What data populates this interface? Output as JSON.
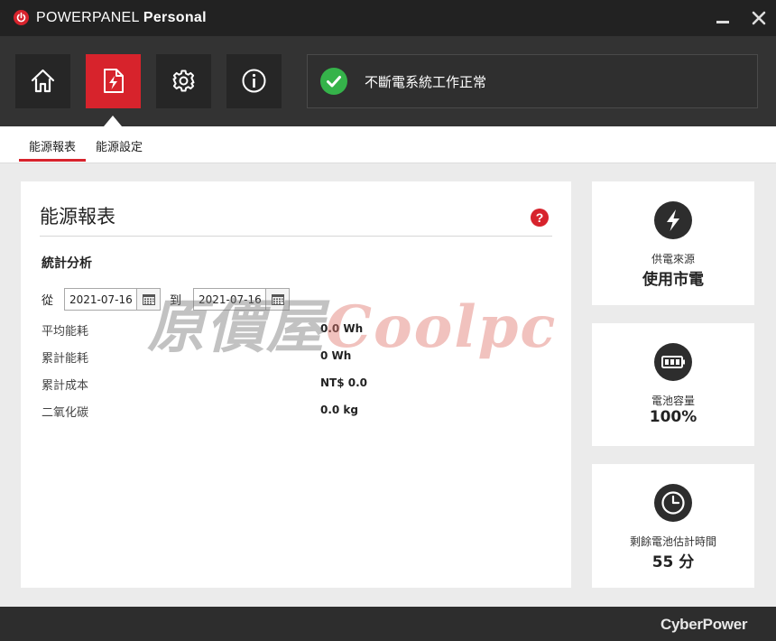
{
  "app": {
    "title_part1": "POWERPANEL",
    "title_part2": "Personal",
    "brand": "CyberPower"
  },
  "window_controls": {
    "minimize_icon": "minimize-icon",
    "close_icon": "close-icon"
  },
  "nav": {
    "items": [
      {
        "name": "home",
        "icon": "home-icon",
        "active": false
      },
      {
        "name": "energy-report",
        "icon": "document-bolt-icon",
        "active": true
      },
      {
        "name": "settings",
        "icon": "gear-icon",
        "active": false
      },
      {
        "name": "info",
        "icon": "info-icon",
        "active": false
      }
    ]
  },
  "status": {
    "icon": "check-circle-icon",
    "text": "不斷電系統工作正常",
    "color": "#35b34a"
  },
  "tabs": [
    {
      "label": "能源報表",
      "active": true
    },
    {
      "label": "能源設定",
      "active": false
    }
  ],
  "report": {
    "title": "能源報表",
    "help_icon": "question-icon",
    "section_title": "統計分析",
    "from_label": "從",
    "to_label": "到",
    "date_from": "2021-07-16",
    "date_to": "2021-07-16",
    "stats": [
      {
        "label": "平均能耗",
        "value": "0.0 Wh"
      },
      {
        "label": "累計能耗",
        "value": "0 Wh"
      },
      {
        "label": "累計成本",
        "value": "NT$ 0.0"
      },
      {
        "label": "二氧化碳",
        "value": "0.0 kg"
      }
    ],
    "watermark_part1": "原價屋",
    "watermark_part2": "Coolpc"
  },
  "side": {
    "power": {
      "icon": "lightning-icon",
      "label": "供電來源",
      "value": "使用市電"
    },
    "battery": {
      "icon": "battery-icon",
      "label": "電池容量",
      "value": "100%",
      "level": 1.0
    },
    "runtime": {
      "icon": "clock-icon",
      "label": "剩餘電池估計時間",
      "value": "55 分"
    }
  },
  "colors": {
    "accent": "#d7232c",
    "titlebar": "#222222",
    "nav_bg": "#333333",
    "content_bg": "#ebebeb"
  }
}
